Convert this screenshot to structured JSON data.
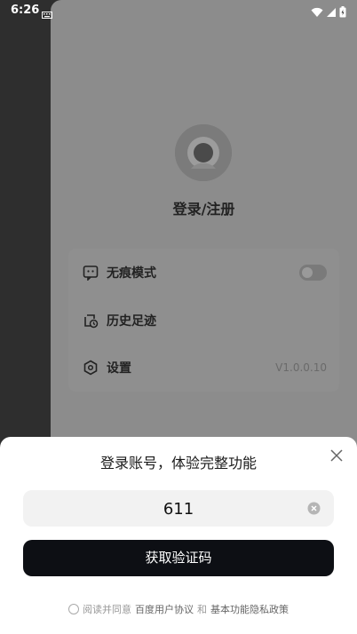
{
  "status_bar": {
    "time": "6:26",
    "icons": [
      "keyboard-icon",
      "wifi-icon",
      "signal-icon",
      "battery-icon"
    ]
  },
  "drawer": {
    "login_title": "登录/注册",
    "menu": [
      {
        "label": "无痕模式",
        "icon": "incognito-icon",
        "control": "toggle",
        "enabled": false
      },
      {
        "label": "历史足迹",
        "icon": "history-icon"
      },
      {
        "label": "设置",
        "icon": "settings-icon",
        "value": "V1.0.0.10"
      }
    ]
  },
  "sheet": {
    "title": "登录账号，体验完整功能",
    "phone_value": "611",
    "get_code_label": "获取验证码",
    "agreement": {
      "prefix": "阅读并同意",
      "link1": "百度用户协议",
      "conj": "和",
      "link2": "基本功能隐私政策"
    }
  },
  "colors": {
    "drawer_bg": "#8c8c8c",
    "primary_button": "#0d0f14",
    "field_bg": "#f2f2f2"
  }
}
